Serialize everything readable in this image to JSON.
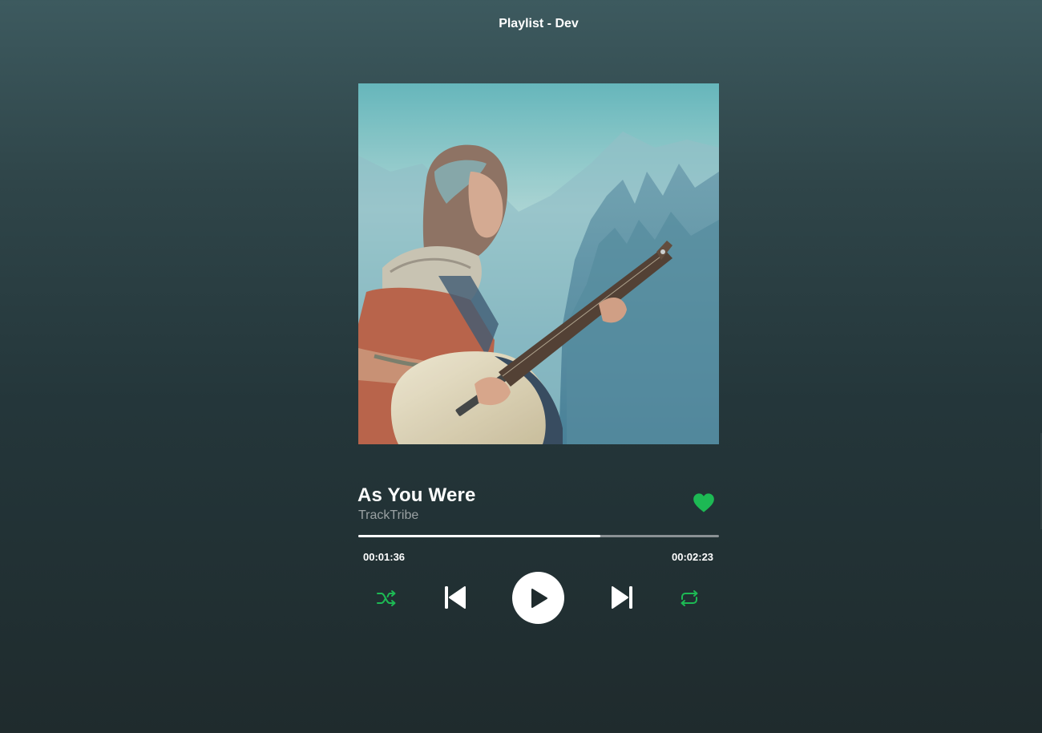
{
  "header": {
    "title": "Playlist - Dev"
  },
  "track": {
    "title": "As You Were",
    "artist": "TrackTribe",
    "liked": true,
    "progress_fraction": 0.67
  },
  "playback": {
    "current_time": "00:01:36",
    "total_time": "00:02:23"
  },
  "controls": {
    "shuffle_icon": "shuffle-icon",
    "previous_icon": "skip-previous-icon",
    "play_icon": "play-icon",
    "next_icon": "skip-next-icon",
    "repeat_icon": "repeat-icon",
    "like_icon": "heart-icon"
  },
  "colors": {
    "accent": "#1db954",
    "text": "#ffffff",
    "muted_text": "#9aa1a3",
    "progress_track": "#8a9194"
  }
}
